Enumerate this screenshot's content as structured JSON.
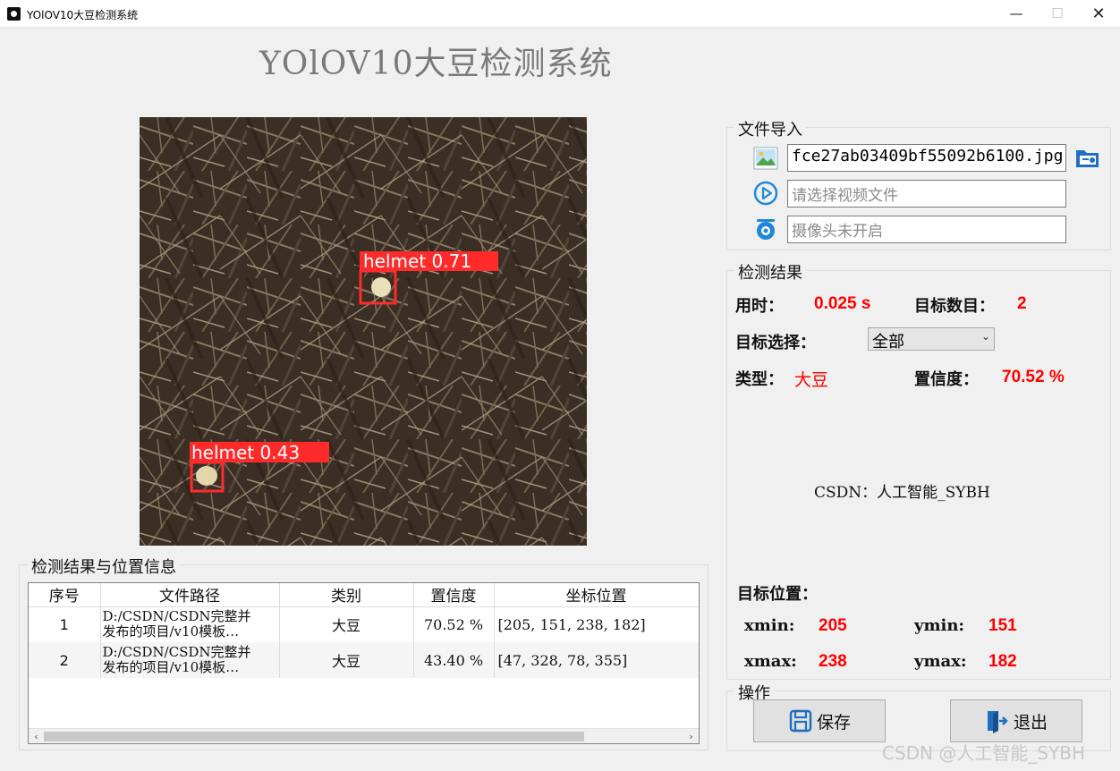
{
  "window": {
    "title": "YOlOV10大豆检测系统"
  },
  "heading": "YOlOV10大豆检测系统",
  "image": {
    "detections": [
      {
        "label": "helmet 0.71"
      },
      {
        "label": "helmet 0.43"
      }
    ]
  },
  "file_import": {
    "title": "文件导入",
    "image_file_value": "fce27ab03409bf55092b6100.jpg",
    "video_placeholder": "请选择视频文件",
    "camera_placeholder": "摄像头未开启"
  },
  "results": {
    "title": "检测结果",
    "time_label": "用时：",
    "time_value": "0.025 s",
    "count_label": "目标数目：",
    "count_value": "2",
    "select_label": "目标选择：",
    "select_value": "全部",
    "type_label": "类型：",
    "type_value": "大豆",
    "conf_label": "置信度：",
    "conf_value": "70.52 %",
    "credit": "CSDN：人工智能_SYBH",
    "position_label": "目标位置：",
    "xmin_label": "xmin:",
    "xmin_value": "205",
    "ymin_label": "ymin:",
    "ymin_value": "151",
    "xmax_label": "xmax:",
    "xmax_value": "238",
    "ymax_label": "ymax:",
    "ymax_value": "182"
  },
  "operations": {
    "title": "操作",
    "save_label": "保存",
    "exit_label": "退出"
  },
  "table": {
    "title": "检测结果与位置信息",
    "headers": [
      "序号",
      "文件路径",
      "类别",
      "置信度",
      "坐标位置"
    ],
    "rows": [
      {
        "index": "1",
        "path_line1": "D:/CSDN/CSDN完整并",
        "path_line2": "发布的项目/v10模板…",
        "cls": "大豆",
        "conf": "70.52 %",
        "coords": "[205, 151, 238, 182]"
      },
      {
        "index": "2",
        "path_line1": "D:/CSDN/CSDN完整并",
        "path_line2": "发布的项目/v10模板…",
        "cls": "大豆",
        "conf": "43.40 %",
        "coords": "[47, 328, 78, 355]"
      }
    ]
  },
  "watermark": "CSDN @人工智能_SYBH",
  "colors": {
    "accent_red": "#ff0000",
    "box_red": "#ff2b2b",
    "icon_blue": "#1e88d8"
  }
}
